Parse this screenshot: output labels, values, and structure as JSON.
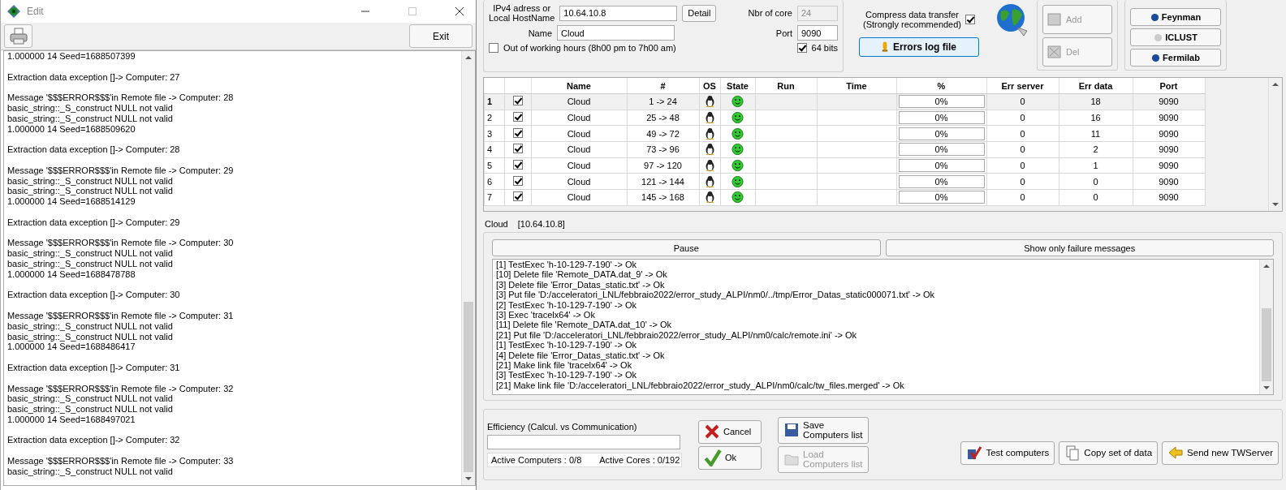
{
  "edit_window": {
    "title": "Edit",
    "exit_button": "Exit",
    "log_blocks": [
      [
        "1.000000 14 Seed=1688507399"
      ],
      [
        "Extraction data exception []-> Computer: 27"
      ],
      [
        "Message '$$$ERROR$$$'in Remote file -> Computer: 28",
        "basic_string::_S_construct NULL not valid",
        "basic_string::_S_construct NULL not valid",
        "1.000000 14 Seed=1688509620"
      ],
      [
        "Extraction data exception []-> Computer: 28"
      ],
      [
        "Message '$$$ERROR$$$'in Remote file -> Computer: 29",
        "basic_string::_S_construct NULL not valid",
        "basic_string::_S_construct NULL not valid",
        "1.000000 14 Seed=1688514129"
      ],
      [
        "Extraction data exception []-> Computer: 29"
      ],
      [
        "Message '$$$ERROR$$$'in Remote file -> Computer: 30",
        "basic_string::_S_construct NULL not valid",
        "basic_string::_S_construct NULL not valid",
        "1.000000 14 Seed=1688478788"
      ],
      [
        "Extraction data exception []-> Computer: 30"
      ],
      [
        "Message '$$$ERROR$$$'in Remote file -> Computer: 31",
        "basic_string::_S_construct NULL not valid",
        "basic_string::_S_construct NULL not valid",
        "1.000000 14 Seed=1688486417"
      ],
      [
        "Extraction data exception []-> Computer: 31"
      ],
      [
        "Message '$$$ERROR$$$'in Remote file -> Computer: 32",
        "basic_string::_S_construct NULL not valid",
        "basic_string::_S_construct NULL not valid",
        "1.000000 14 Seed=1688497021"
      ],
      [
        "Extraction data exception []-> Computer: 32"
      ],
      [
        "Message '$$$ERROR$$$'in Remote file -> Computer: 33",
        "basic_string::_S_construct NULL not valid"
      ]
    ]
  },
  "host_panel": {
    "address_label": [
      "IPv4 adress or",
      "Local HostName"
    ],
    "address_value": "10.64.10.8",
    "detail_button": "Detail",
    "cores_label": "Nbr of core",
    "cores_value": "24",
    "cores_disabled": true,
    "name_label": "Name",
    "name_value": "Cloud",
    "port_label": "Port",
    "port_value": "9090",
    "out_of_hours": {
      "label": "Out of working hours (8h00 pm to 7h00 am)",
      "checked": false
    },
    "bits64": {
      "label": "64 bits",
      "checked": true
    },
    "compress": {
      "label": [
        "Compress data transfer",
        "(Strongly recommended)"
      ],
      "checked": true
    },
    "errors_log_button": "Errors log file"
  },
  "side_buttons": [
    {
      "label": "Add",
      "disabled": true
    },
    {
      "label": "Del",
      "disabled": true
    }
  ],
  "lab_buttons": [
    "Feynman",
    "ICLUST",
    "Fermilab"
  ],
  "table": {
    "columns": [
      "Name",
      "#",
      "OS",
      "State",
      "Run",
      "Time",
      "%",
      "Err server",
      "Err data",
      "Port"
    ],
    "rows": [
      {
        "index": "1",
        "selected": true,
        "checked": true,
        "name": "Cloud",
        "range": "1 -> 24",
        "percent": "0%",
        "level": 0,
        "err_server": "0",
        "err_data": "18",
        "port": "9090"
      },
      {
        "index": "2",
        "selected": false,
        "checked": true,
        "name": "Cloud",
        "range": "25 -> 48",
        "percent": "0%",
        "level": 0,
        "err_server": "0",
        "err_data": "16",
        "port": "9090"
      },
      {
        "index": "3",
        "selected": false,
        "checked": true,
        "name": "Cloud",
        "range": "49 -> 72",
        "percent": "0%",
        "level": 0,
        "err_server": "0",
        "err_data": "11",
        "port": "9090"
      },
      {
        "index": "4",
        "selected": false,
        "checked": true,
        "name": "Cloud",
        "range": "73 -> 96",
        "percent": "0%",
        "level": 0,
        "err_server": "0",
        "err_data": "2",
        "port": "9090"
      },
      {
        "index": "5",
        "selected": false,
        "checked": true,
        "name": "Cloud",
        "range": "97 -> 120",
        "percent": "0%",
        "level": 0,
        "err_server": "0",
        "err_data": "1",
        "port": "9090"
      },
      {
        "index": "6",
        "selected": false,
        "checked": true,
        "name": "Cloud",
        "range": "121 -> 144",
        "percent": "0%",
        "level": 0,
        "err_server": "0",
        "err_data": "0",
        "port": "9090"
      },
      {
        "index": "7",
        "selected": false,
        "checked": true,
        "name": "Cloud",
        "range": "145 -> 168",
        "percent": "0%",
        "level": 0,
        "err_server": "0",
        "err_data": "0",
        "port": "9090"
      }
    ]
  },
  "selected_host": {
    "name": "Cloud",
    "address": "[10.64.10.8]"
  },
  "messages_panel": {
    "pause_button": "Pause",
    "failure_button": "Show only failure messages",
    "lines": [
      "[1] TestExec 'h-10-129-7-190' -> Ok",
      "[10] Delete file 'Remote_DATA.dat_9' -> Ok",
      "[3] Delete file 'Error_Datas_static.txt' -> Ok",
      "[3] Put file 'D:/acceleratori_LNL/febbraio2022/error_study_ALPI/nm0/../tmp/Error_Datas_static000071.txt' -> Ok",
      "[2] TestExec 'h-10-129-7-190' -> Ok",
      "[3] Exec 'tracelx64' -> Ok",
      "[11] Delete file 'Remote_DATA.dat_10' -> Ok",
      "[21] Put file 'D:/acceleratori_LNL/febbraio2022/error_study_ALPI/nm0/calc/remote.ini' -> Ok",
      "[1] TestExec 'h-10-129-7-190' -> Ok",
      "[4] Delete file 'Error_Datas_static.txt' -> Ok",
      "[21] Make link file 'tracelx64' -> Ok",
      "[3] TestExec 'h-10-129-7-190' -> Ok",
      "[21] Make link file 'D:/acceleratori_LNL/febbraio2022/error_study_ALPI/nm0/calc/tw_files.merged' -> Ok"
    ]
  },
  "bottom": {
    "efficiency": {
      "label": "Efficiency (Calcul. vs Communication)",
      "level": 0
    },
    "active_computers": "Active Computers : 0/8",
    "active_cores": "Active Cores : 0/192",
    "cancel_button": "Cancel",
    "ok_button": "Ok",
    "save_button": {
      "label": [
        "Save",
        "Computers list"
      ],
      "disabled": false
    },
    "load_button": {
      "label": [
        "Load",
        "Computers list"
      ],
      "disabled": true
    },
    "action_buttons": [
      "Test computers",
      "Copy set of data",
      "Send new TWServer"
    ]
  }
}
